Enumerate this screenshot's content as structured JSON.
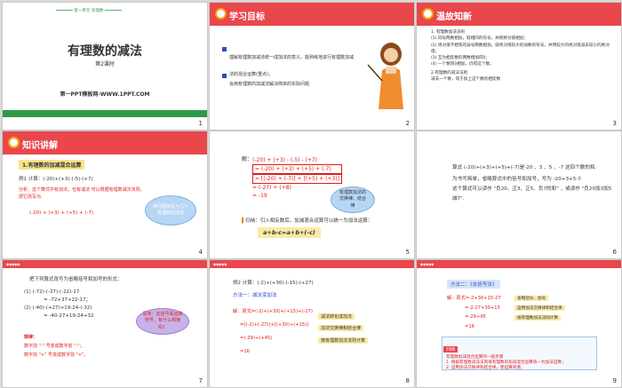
{
  "slides": [
    {
      "num": "1",
      "top_tag": "第一单元 有理数",
      "title": "有理数的减法",
      "subtitle": "第2课时",
      "footer": "第一PPT模板网-WWW.1PPT.COM"
    },
    {
      "num": "2",
      "header": "学习目标",
      "goals": [
        "理解有理数加减法统一成加法的意义，能熟练地进行有理数加减法的混合运算(重点)；",
        "会用有理数的加减法解决简单的实际问题"
      ]
    },
    {
      "num": "3",
      "header": "温故知新",
      "lines": [
        "1. 有理数加法法则",
        "(1) 同号两数相加，取相同的符号，并把绝对值相加；",
        "(2) 绝对值不相等的异号两数相加，取绝对值较大的加数的符号，并用较大的绝对值减去较小的绝对值；",
        "(3) 互为相反数的两数相加得0；",
        "(4) 一个数同0相加，仍得这个数。",
        "2.有理数的减法法则",
        "减去一个数，等于加上这个数的相反数"
      ]
    },
    {
      "num": "4",
      "header": "知识讲解",
      "section": "1.有理数的加减混合运算",
      "example": "例1 计算：(-20)+(+3)-(-5)-(+7)",
      "analysis": "分析：这个算式中有加法，也有减法 可以根据有理数减法法则，把它改写为",
      "rewrite": "(-20) + (+3) + (+5) + (-7)",
      "cloud": "使问题转化为几个有理数的加法"
    },
    {
      "num": "5",
      "label": "解：",
      "steps": [
        "(-20) + (+3) - (-5) - (+7)",
        "= (-20) + (+3) + (+5) + (-7)",
        "= [(-20) + (-7)] + [(+5) + (+3)]",
        "= (-27) + (+8)",
        "= -19"
      ],
      "cloud": "有理数加法的交换律、结合律",
      "summary": "归纳：引入相反数后，加减混合运算可以统一为加法运算：",
      "formula": "a+b-c=a+b+(-c)"
    },
    {
      "num": "6",
      "text1": "算式 (-20)+(+3)+(+5)+(-7)是-20 、3 、5 、-7 这四个数的和.",
      "text2": "为书写简单，省略算式中的括号和加号，写为 -20+3+5-7.",
      "text3": "这个算式可以读作 \"负20、正3、正5、负7的和\" ，或读作 \"负20加3加5减7\"."
    },
    {
      "num": "7",
      "prompt": "把下列算式改写为省略括号和加号的形式：",
      "lines": [
        "(1) (-72)-(-37)-(-22)-17",
        "= -72+37+22-17；",
        "(2) (-40)-(+27)+19-24-(-32)",
        "= -40-27+19-24+32"
      ],
      "cloud": "思考：去括号看运算符号，有什么规律吗？",
      "rule_title": "规律：",
      "rule1": "数字前 \"-\" 号变成数字前 \"-\"；",
      "rule2": "数字前 \"+\" 号变成数字前 \"+\"。"
    },
    {
      "num": "8",
      "example": "例2 计算：(-2)+(+30)-(-15)-(+27)",
      "method": "方法一：减法变加法",
      "steps": [
        "解：原式=(-2)+(+30)+(+15)+(-27)",
        "=[(-2)+(-27)]+[(+30)+(+15)]",
        "=(-29)+(+45)",
        "=16"
      ],
      "notes": [
        "减法转化成加法",
        "加法交换律和结合律",
        "按有理数加法法则计算"
      ]
    },
    {
      "num": "9",
      "method": "方法二：《去括号法》",
      "steps": [
        "解：原式=-2+30+15-27",
        "=-2-27+30+15",
        "=-29+45",
        "=16"
      ],
      "notes": [
        "省略括号、加号",
        "运用加法交换律和结合律",
        "按有理数加法法则计算"
      ],
      "summary_title": "归纳",
      "summary": [
        "有理数加减混合运算的一般步骤",
        "1. 根据有理数减法法则将有理数的加减混合运算统一为加法运算；",
        "2. 运用加法交换律和结合律，使运算简便。"
      ]
    }
  ]
}
